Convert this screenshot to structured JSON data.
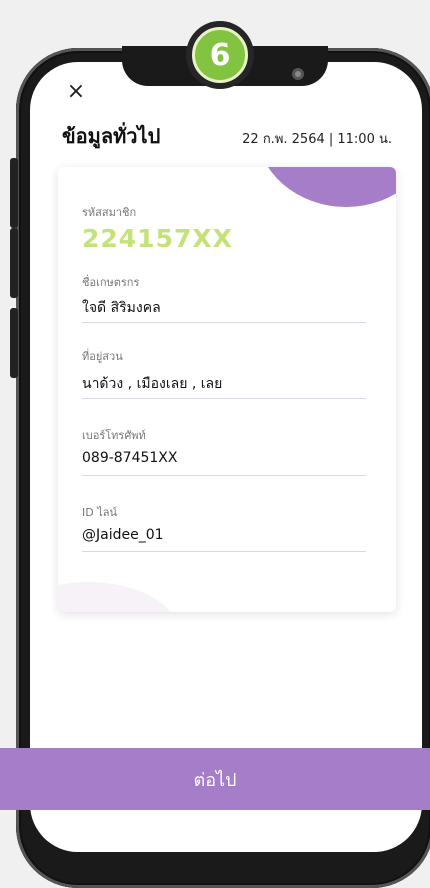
{
  "step": {
    "number": "6"
  },
  "header": {
    "close_symbol": "×",
    "title": "ข้อมูลทั่วไป",
    "datetime": "22 ก.พ. 2564  | 11:00 น."
  },
  "member": {
    "label": "รหัสสมาชิก",
    "id": "224157XX"
  },
  "fields": [
    {
      "label": "ชื่อเกษตรกร",
      "value": "ใจดี สิริมงคล"
    },
    {
      "label": "ที่อยู่สวน",
      "value": "นาด้วง , เมืองเลย , เลย"
    },
    {
      "label": "เบอร์โทรศัพท์",
      "value": "089-87451XX"
    },
    {
      "label": "ID ไลน์",
      "value": "@Jaidee_01"
    }
  ],
  "footer": {
    "next_label": "ต่อไป"
  },
  "colors": {
    "accent": "#a57dc8",
    "member_id": "#c5e27a",
    "step_badge": "#82c341"
  }
}
